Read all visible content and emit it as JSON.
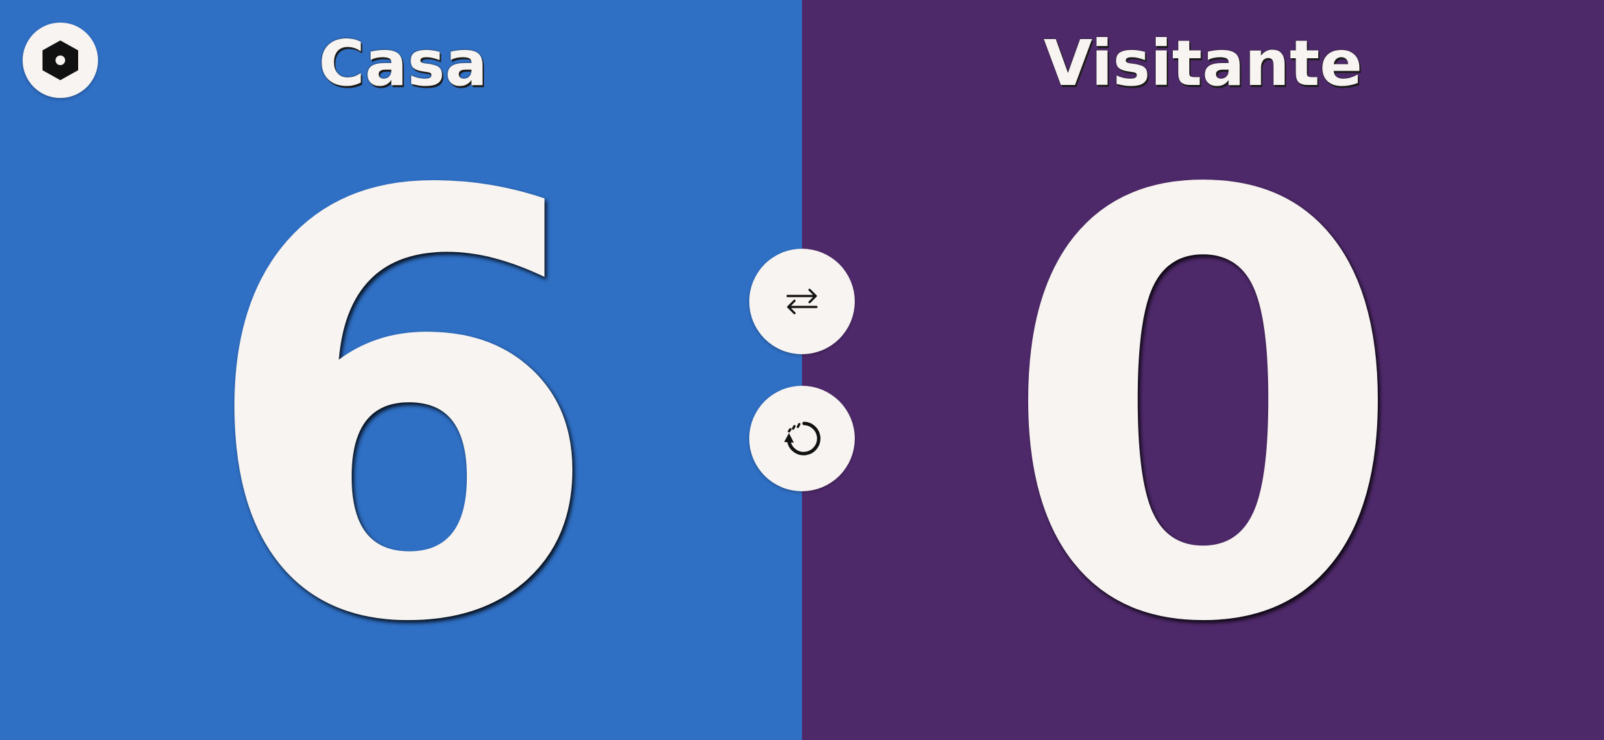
{
  "home": {
    "team_name": "Casa",
    "score": "6",
    "color": "#2f6fc4"
  },
  "away": {
    "team_name": "Visitante",
    "score": "0",
    "color": "#4e296a"
  },
  "controls": {
    "settings_icon": "hexagon-settings-icon",
    "swap_icon": "swap-arrows-icon",
    "reset_icon": "reset-history-icon",
    "button_color": "#f8f4f1"
  }
}
